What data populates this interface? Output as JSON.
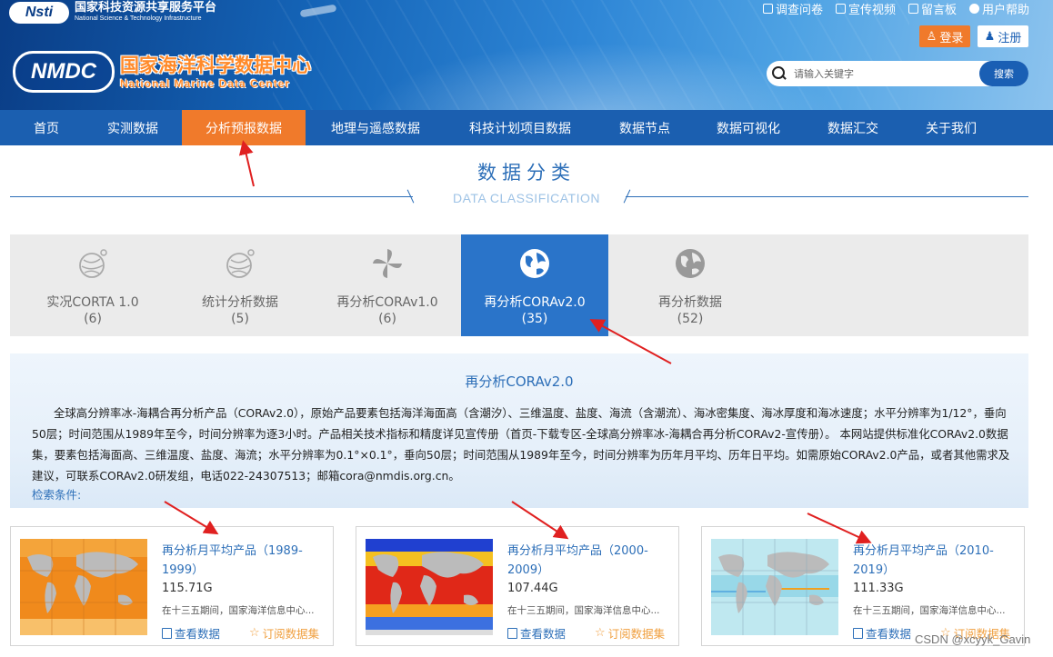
{
  "header": {
    "nsti_logo": "Nsti",
    "nsti_cn": "国家科技资源共享服务平台",
    "nsti_en": "National Science & Technology Infrastructure",
    "nmdc_logo": "NMDC",
    "nmdc_cn": "国家海洋科学数据中心",
    "nmdc_en": "National Marine Data Center",
    "top_links": [
      "调查问卷",
      "宣传视频",
      "留言板",
      "用户帮助"
    ],
    "login_label": "登录",
    "register_label": "注册",
    "search_placeholder": "请输入关键字",
    "search_button": "搜索"
  },
  "nav": {
    "items": [
      "首页",
      "实测数据",
      "分析预报数据",
      "地理与遥感数据",
      "科技计划项目数据",
      "数据节点",
      "数据可视化",
      "数据汇交",
      "关于我们"
    ],
    "active_index": 2
  },
  "section": {
    "title": "数据分类",
    "subtitle": "DATA CLASSIFICATION"
  },
  "categories": [
    {
      "label": "实况CORTA 1.0",
      "count": "(6)",
      "icon": "globe-lines-icon"
    },
    {
      "label": "统计分析数据",
      "count": "(5)",
      "icon": "globe-lines-icon"
    },
    {
      "label": "再分析CORAv1.0",
      "count": "(6)",
      "icon": "pinwheel-icon"
    },
    {
      "label": "再分析CORAv2.0",
      "count": "(35)",
      "icon": "globe-icon"
    },
    {
      "label": "再分析数据",
      "count": "(52)",
      "icon": "globe-icon"
    }
  ],
  "active_category": 3,
  "description": {
    "title": "再分析CORAv2.0",
    "body": "全球高分辨率冰-海耦合再分析产品（CORAv2.0），原始产品要素包括海洋海面高（含潮汐）、三维温度、盐度、海流（含潮流）、海冰密集度、海冰厚度和海冰速度；水平分辨率为1/12°，垂向50层；时间范围从1989年至今，时间分辨率为逐3小时。产品相关技术指标和精度详见宣传册（首页-下载专区-全球高分辨率冰-海耦合再分析CORAv2-宣传册）。 本网站提供标准化CORAv2.0数据集，要素包括海面高、三维温度、盐度、海流；水平分辨率为0.1°×0.1°，垂向50层；时间范围从1989年至今，时间分辨率为历年月平均、历年日平均。如需原始CORAv2.0产品，或者其他需求及建议，可联系CORAv2.0研发组，电话022-24307513；邮箱cora@nmdis.org.cn。",
    "search_conditions": "检索条件:"
  },
  "products": [
    {
      "name": "再分析月平均产品（1989-1999）",
      "size": "115.71G",
      "org": "在十三五期间，国家海洋信息中心...",
      "view": "查看数据",
      "subscribe": "订阅数据集",
      "map_style": "warm"
    },
    {
      "name": "再分析月平均产品（2000-2009）",
      "size": "107.44G",
      "org": "在十三五期间，国家海洋信息中心...",
      "view": "查看数据",
      "subscribe": "订阅数据集",
      "map_style": "sst"
    },
    {
      "name": "再分析月平均产品（2010-2019）",
      "size": "111.33G",
      "org": "在十三五期间，国家海洋信息中心...",
      "view": "查看数据",
      "subscribe": "订阅数据集",
      "map_style": "light"
    }
  ],
  "watermark": "CSDN @xcyyk_Gavin",
  "colors": {
    "nav_bg": "#1b5fb0",
    "accent_orange": "#f07a2b",
    "link_blue": "#2d6fb8",
    "active_blue": "#2a74c9",
    "annotation_red": "#e02020"
  }
}
